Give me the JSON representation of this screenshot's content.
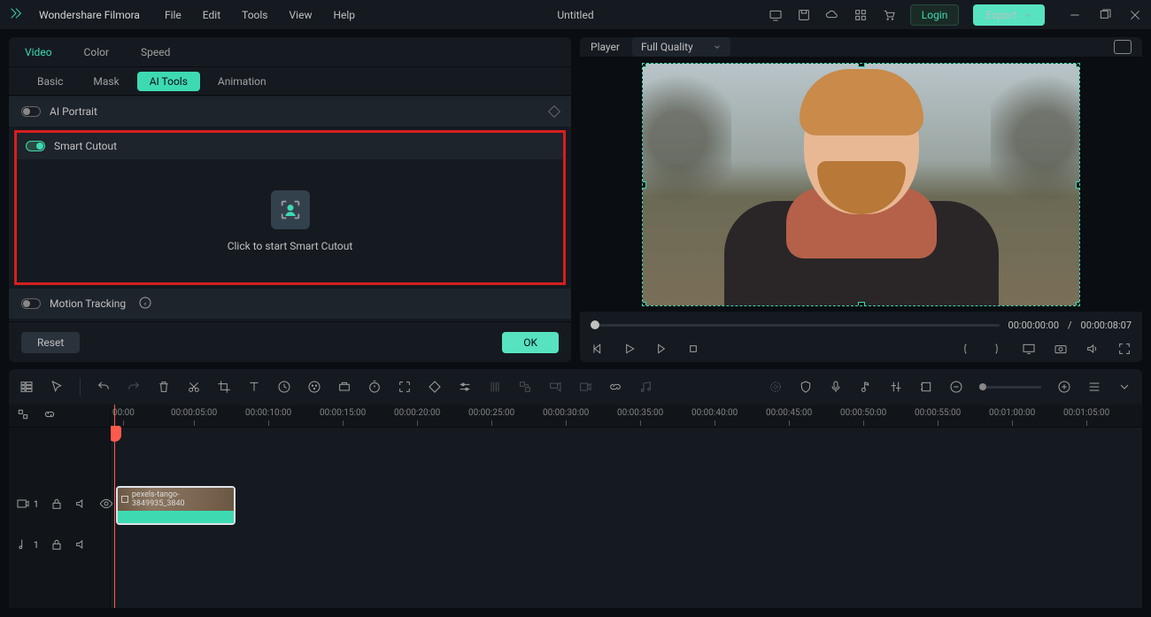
{
  "app_title": "Wondershare Filmora",
  "menu": [
    "File",
    "Edit",
    "Tools",
    "View",
    "Help"
  ],
  "doc_title": "Untitled",
  "login": "Login",
  "export": "Export",
  "tabs_top": [
    "Video",
    "Color",
    "Speed"
  ],
  "tabs_sub": [
    "Basic",
    "Mask",
    "AI Tools",
    "Animation"
  ],
  "feat_ai_portrait": "AI Portrait",
  "feat_smart_cutout": "Smart Cutout",
  "smart_cutout_caption": "Click to start Smart Cutout",
  "feat_motion_tracking": "Motion Tracking",
  "btn_reset": "Reset",
  "btn_ok": "OK",
  "player_label": "Player",
  "quality_label": "Full Quality",
  "time_current": "00:00:00:00",
  "time_sep": "/",
  "time_total": "00:00:08:07",
  "ruler_ticks": [
    "00:00",
    "00:00:05:00",
    "00:00:10:00",
    "00:00:15:00",
    "00:00:20:00",
    "00:00:25:00",
    "00:00:30:00",
    "00:00:35:00",
    "00:00:40:00",
    "00:00:45:00",
    "00:00:50:00",
    "00:00:55:00",
    "00:01:00:00",
    "00:01:05:00"
  ],
  "clip_name": "pexels-tango-3849935_3840",
  "track_v_label": "1",
  "track_a_label": "1"
}
